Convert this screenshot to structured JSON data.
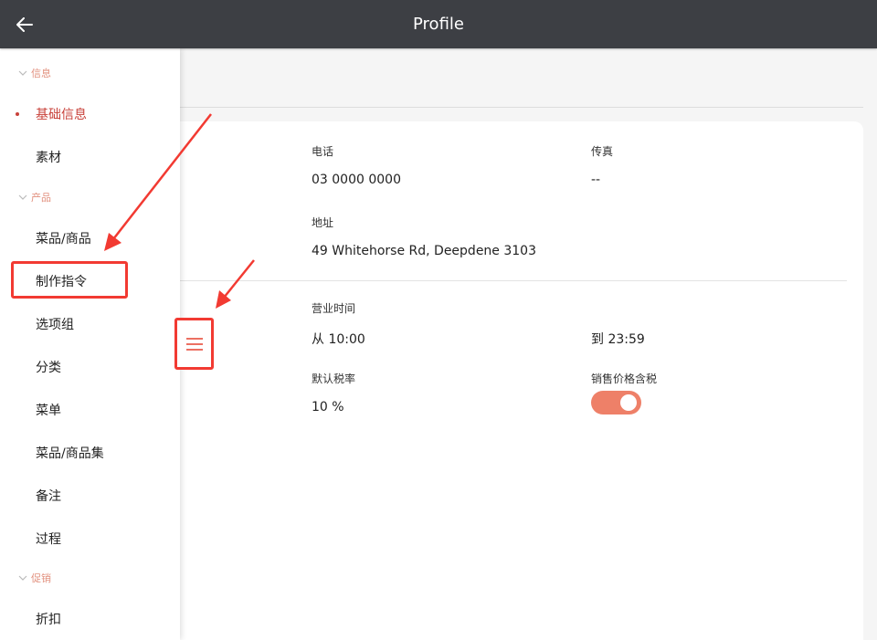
{
  "header": {
    "title": "Profile",
    "back_icon": "arrow-left-icon"
  },
  "sidebar": {
    "sections": [
      {
        "label": "信息"
      },
      {
        "label": "产品"
      },
      {
        "label": "促销"
      }
    ],
    "items": [
      {
        "label": "基础信息",
        "active": true
      },
      {
        "label": "素材"
      },
      {
        "label": "菜品/商品"
      },
      {
        "label": "制作指令"
      },
      {
        "label": "选项组"
      },
      {
        "label": "分类"
      },
      {
        "label": "菜单"
      },
      {
        "label": "菜品/商品集"
      },
      {
        "label": "备注"
      },
      {
        "label": "过程"
      },
      {
        "label": "折扣"
      }
    ]
  },
  "profile": {
    "phone_label": "电话",
    "phone_value": "03 0000 0000",
    "fax_label": "传真",
    "fax_value": "--",
    "address_label": "地址",
    "address_value": "49 Whitehorse Rd, Deepdene 3103",
    "hours_label": "营业时间",
    "hours_from": "从 10:00",
    "hours_to": "到 23:59",
    "tax_label": "默认税率",
    "tax_value": "10 %",
    "tax_included_label": "销售价格含税",
    "tax_included": true
  },
  "colors": {
    "header_bg": "#3d3f44",
    "accent": "#c8413a",
    "toggle_on": "#ee8068",
    "annotation": "#f23a32"
  }
}
